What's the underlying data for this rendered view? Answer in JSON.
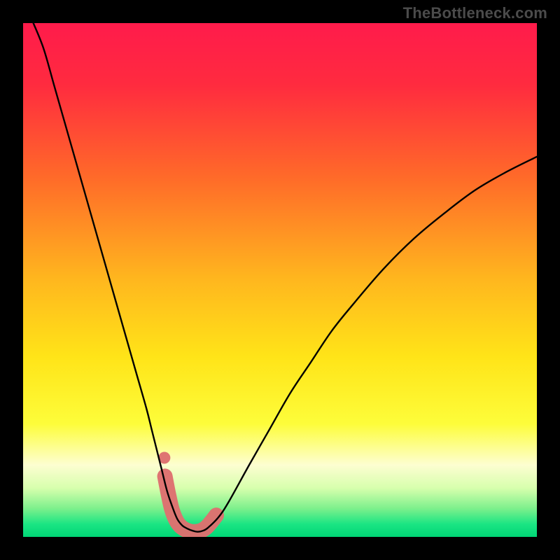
{
  "watermark": "TheBottleneck.com",
  "chart_data": {
    "type": "line",
    "title": "",
    "xlabel": "",
    "ylabel": "",
    "xlim": [
      0,
      100
    ],
    "ylim": [
      0,
      100
    ],
    "grid": false,
    "legend": false,
    "annotations": [],
    "background_gradient": {
      "stops": [
        {
          "pos": 0.0,
          "color": "#ff1b4b"
        },
        {
          "pos": 0.12,
          "color": "#ff2b3f"
        },
        {
          "pos": 0.3,
          "color": "#ff6a29"
        },
        {
          "pos": 0.5,
          "color": "#ffb71e"
        },
        {
          "pos": 0.65,
          "color": "#ffe418"
        },
        {
          "pos": 0.78,
          "color": "#fdfd3a"
        },
        {
          "pos": 0.86,
          "color": "#fdfed1"
        },
        {
          "pos": 0.905,
          "color": "#d7ffad"
        },
        {
          "pos": 0.945,
          "color": "#7cf08c"
        },
        {
          "pos": 0.975,
          "color": "#1be583"
        },
        {
          "pos": 1.0,
          "color": "#00d676"
        }
      ]
    },
    "series": [
      {
        "name": "bottleneck-curve",
        "color": "#000000",
        "x": [
          2,
          4,
          6,
          8,
          10,
          12,
          14,
          16,
          18,
          20,
          22,
          24,
          25,
          26,
          27,
          28,
          29,
          30,
          31,
          32,
          33,
          34,
          35,
          36,
          38,
          40,
          44,
          48,
          52,
          56,
          60,
          64,
          70,
          76,
          82,
          88,
          94,
          100
        ],
        "y": [
          100,
          95,
          88,
          81,
          74,
          67,
          60,
          53,
          46,
          39,
          32,
          25,
          21,
          17,
          13,
          9,
          6,
          3.5,
          2.2,
          1.6,
          1.2,
          1.0,
          1.2,
          1.8,
          3.8,
          6.8,
          14,
          21,
          28,
          34,
          40,
          45,
          52,
          58,
          63,
          67.5,
          71,
          74
        ]
      }
    ],
    "highlight_band": {
      "name": "optimal-range",
      "color": "#de7070",
      "points": [
        {
          "x": 27.6,
          "y": 11.8
        },
        {
          "x": 28.3,
          "y": 8.2
        },
        {
          "x": 29.0,
          "y": 5.2
        },
        {
          "x": 29.8,
          "y": 3.2
        },
        {
          "x": 30.6,
          "y": 2.1
        },
        {
          "x": 31.6,
          "y": 1.4
        },
        {
          "x": 32.6,
          "y": 1.05
        },
        {
          "x": 33.6,
          "y": 1.0
        },
        {
          "x": 34.6,
          "y": 1.2
        },
        {
          "x": 35.6,
          "y": 1.8
        },
        {
          "x": 36.6,
          "y": 2.9
        },
        {
          "x": 37.6,
          "y": 4.2
        }
      ]
    }
  }
}
